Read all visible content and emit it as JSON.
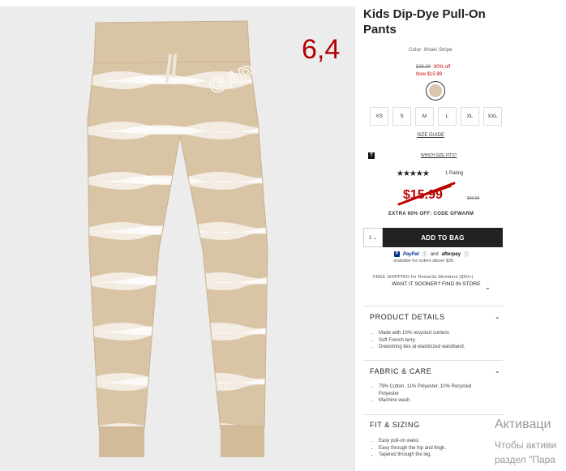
{
  "annotation": {
    "price_text": "6,4"
  },
  "product": {
    "title": "Kids Dip-Dye Pull-On Pants",
    "color_label": "Color: Khaki Stripe",
    "was_price": "$39.99",
    "percent_off": "60% off",
    "now_price": "Now $15.99",
    "swatch_color": "#d8c6ad",
    "sizes": [
      "XS",
      "S",
      "M",
      "L",
      "XL",
      "XXL"
    ],
    "size_guide": "SIZE GUIDE",
    "which_size": "WHICH SIZE FITS?",
    "t_badge": "T",
    "stars": "★★★★★",
    "rating_text": "1 Rating",
    "big_price": "$15.99",
    "small_old_price": "$39.99",
    "extra_offer": "EXTRA 60% OFF: CODE GFWARM",
    "qty_value": "1 ⌄",
    "add_to_bag": "ADD TO BAG",
    "paypal_label": "PayPal",
    "paypal_info": "ⓘ",
    "and_text": "and",
    "afterpay_label": "afterpay",
    "afterpay_info": "ⓘ",
    "available_text": "available for orders above $35",
    "free_shipping": "FREE SHIPPING for Rewards Members ($50+)",
    "want_it_sooner": "WANT IT SOONER? FIND IN STORE"
  },
  "sections": [
    {
      "title": "PRODUCT DETAILS",
      "items": [
        "Made with 10% recycled content.",
        "Soft French terry.",
        "Drawstring ties at elasticized waistband."
      ]
    },
    {
      "title": "FABRIC & CARE",
      "items": [
        "79% Cotton, 11% Polyester, 10% Recycled Polyester",
        "Machine wash."
      ]
    },
    {
      "title": "FIT & SIZING",
      "items": [
        "Easy pull-on waist.",
        "Easy through the hip and thigh.",
        "Tapered through the leg."
      ]
    }
  ],
  "os_watermark": {
    "line1": "Активаци",
    "line2": "Чтобы активи",
    "line3": "раздел \"Пара"
  },
  "colors": {
    "accent_red": "#c00000",
    "button_bg": "#222222",
    "pants": "#d9c4a6"
  }
}
